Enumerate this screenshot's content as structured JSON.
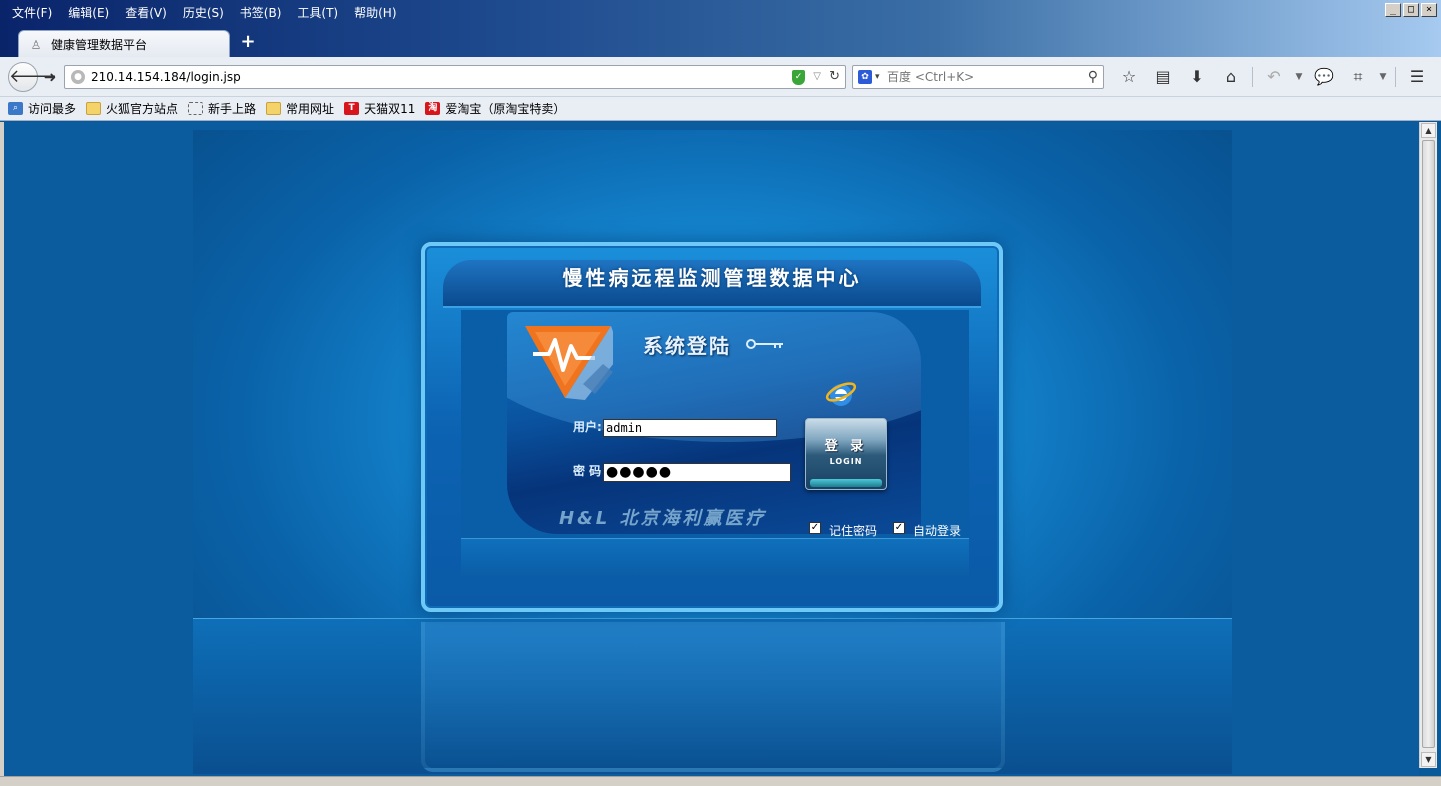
{
  "menu": [
    "文件(F)",
    "编辑(E)",
    "查看(V)",
    "历史(S)",
    "书签(B)",
    "工具(T)",
    "帮助(H)"
  ],
  "window_controls": {
    "minimize": "_",
    "maximize": "□",
    "close": "×"
  },
  "tab": {
    "label": "健康管理数据平台",
    "icon": "user-icon"
  },
  "new_tab_label": "+",
  "nav": {
    "url": "210.14.154.184/login.jsp",
    "search_engine": "百度",
    "search_placeholder": "百度 <Ctrl+K>"
  },
  "bookmarks": [
    {
      "label": "访问最多",
      "icon": "most-visited-icon"
    },
    {
      "label": "火狐官方站点",
      "icon": "folder-icon"
    },
    {
      "label": "新手上路",
      "icon": "dotted-page-icon"
    },
    {
      "label": "常用网址",
      "icon": "folder-icon"
    },
    {
      "label": "天猫双11",
      "icon": "tmall-icon"
    },
    {
      "label": "爱淘宝（原淘宝特卖）",
      "icon": "taobao-icon"
    }
  ],
  "login": {
    "header_title": "慢性病远程监测管理数据中心",
    "system_title": "系统登陆",
    "username_label": "用户:",
    "password_label": "密 码",
    "username_value": "admin",
    "password_value": "●●●●●",
    "button_cn": "登 录",
    "button_en": "LOGIN",
    "brand": "H&L 北京海利赢医疗",
    "remember_label": "记住密码",
    "auto_login_label": "自动登录",
    "remember_checked": true,
    "auto_login_checked": true
  },
  "colors": {
    "titlebar": "#0a246a",
    "panel_border": "#6fc9f7",
    "stage_center": "#28b4f4",
    "logo_orange": "#f0731e"
  }
}
